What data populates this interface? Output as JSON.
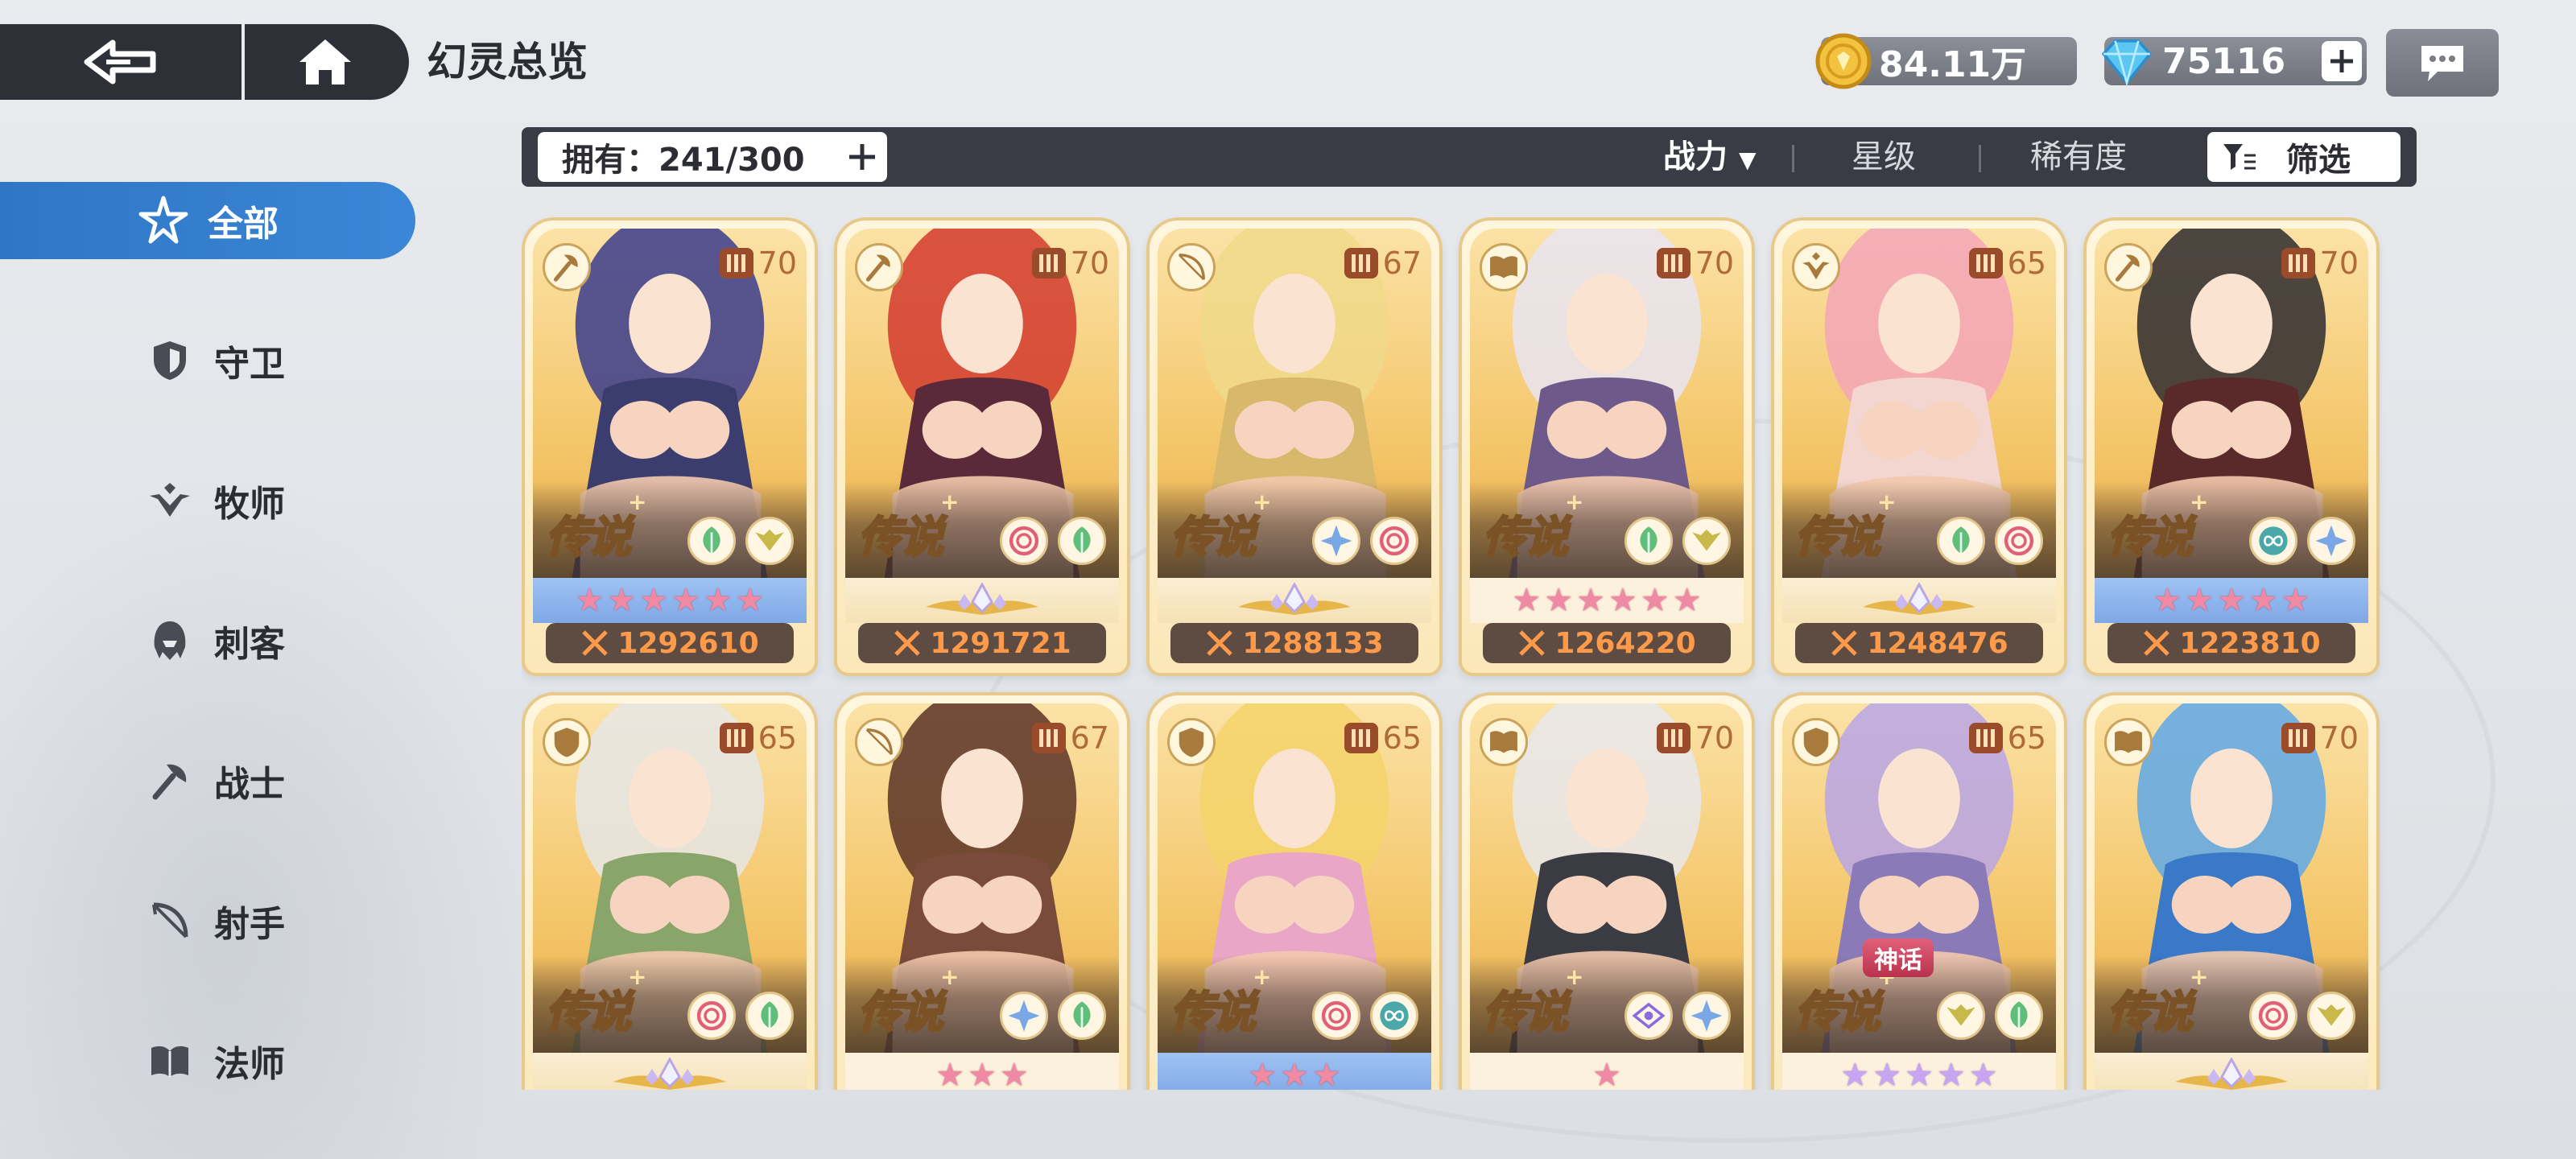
{
  "header": {
    "title": "幻灵总览",
    "back_icon": "back-arrow-icon",
    "home_icon": "home-icon"
  },
  "currency": {
    "gold": "84.11万",
    "gems": "75116",
    "plus": "+"
  },
  "sidebar": {
    "items": [
      {
        "label": "全部",
        "icon": "all-star-icon",
        "active": true
      },
      {
        "label": "守卫",
        "icon": "shield-icon",
        "active": false
      },
      {
        "label": "牧师",
        "icon": "priest-icon",
        "active": false
      },
      {
        "label": "刺客",
        "icon": "assassin-icon",
        "active": false
      },
      {
        "label": "战士",
        "icon": "axe-icon",
        "active": false
      },
      {
        "label": "射手",
        "icon": "bow-icon",
        "active": false
      },
      {
        "label": "法师",
        "icon": "book-icon",
        "active": false
      }
    ]
  },
  "filter_bar": {
    "owned": "拥有：241/300",
    "sort_power": "战力",
    "sort_power_arrow": "▼",
    "sort_star": "星级",
    "sort_rarity": "稀有度",
    "filter": "筛选"
  },
  "cards": [
    {
      "class": "axe-icon",
      "level": "70",
      "rarity": "传说",
      "elements": [
        "leaf-icon",
        "wings-icon"
      ],
      "star_style": "blue",
      "stars": 6,
      "power": "1292610",
      "tone": "#3b3d6e",
      "hair": "#3a3c8c"
    },
    {
      "class": "axe-icon",
      "level": "70",
      "rarity": "传说",
      "elements": [
        "spiral-icon",
        "leaf-icon"
      ],
      "star_style": "gold",
      "stars": 0,
      "power": "1291721",
      "tone": "#5a2a3a",
      "hair": "#d43a2e"
    },
    {
      "class": "bow-icon",
      "level": "67",
      "rarity": "传说",
      "elements": [
        "star-icon",
        "spiral-icon"
      ],
      "star_style": "gold",
      "stars": 0,
      "power": "1288133",
      "tone": "#d8b86a",
      "hair": "#f0d98a"
    },
    {
      "class": "book-icon",
      "level": "70",
      "rarity": "传说",
      "elements": [
        "leaf-icon",
        "wings-icon"
      ],
      "star_style": "plain",
      "stars": 6,
      "power": "1264220",
      "tone": "#6e5a8a",
      "hair": "#e9e4f2"
    },
    {
      "class": "priest-icon",
      "level": "65",
      "rarity": "传说",
      "elements": [
        "leaf-icon",
        "spiral-icon"
      ],
      "star_style": "gold",
      "stars": 0,
      "power": "1248476",
      "tone": "#f2d6cf",
      "hair": "#f3a6b8"
    },
    {
      "class": "axe-icon",
      "level": "70",
      "rarity": "传说",
      "elements": [
        "infinity-icon",
        "star-icon"
      ],
      "star_style": "blue",
      "stars": 5,
      "power": "1223810",
      "tone": "#5a2a2a",
      "hair": "#2e2a2e"
    },
    {
      "class": "shield-icon",
      "level": "65",
      "rarity": "传说",
      "elements": [
        "spiral-icon",
        "leaf-icon"
      ],
      "star_style": "gold",
      "stars": 0,
      "power": "",
      "tone": "#8aa56a",
      "hair": "#e6e6e6"
    },
    {
      "class": "bow-icon",
      "level": "67",
      "rarity": "传说",
      "elements": [
        "star-icon",
        "leaf-icon"
      ],
      "star_style": "plain",
      "stars": 3,
      "power": "",
      "tone": "#7a4a3a",
      "hair": "#5a3326"
    },
    {
      "class": "shield-icon",
      "level": "65",
      "rarity": "传说",
      "elements": [
        "spiral-icon",
        "infinity-icon"
      ],
      "star_style": "blue",
      "stars": 3,
      "power": "",
      "tone": "#e9a6c6",
      "hair": "#f4d36a"
    },
    {
      "class": "book-icon",
      "level": "70",
      "rarity": "传说",
      "elements": [
        "eye-icon",
        "star-icon"
      ],
      "star_style": "plain",
      "stars": 1,
      "power": "",
      "tone": "#3b3b44",
      "hair": "#e8e8ec"
    },
    {
      "class": "shield-icon",
      "level": "65",
      "rarity": "传说",
      "badge": "神话",
      "elements": [
        "wings-icon",
        "leaf-icon"
      ],
      "star_style": "purple",
      "stars": 5,
      "power": "",
      "tone": "#8a7ab8",
      "hair": "#b8a6e6"
    },
    {
      "class": "book-icon",
      "level": "70",
      "rarity": "传说",
      "elements": [
        "spiral-icon",
        "wings-icon"
      ],
      "star_style": "gold",
      "stars": 0,
      "power": "",
      "tone": "#3a78c8",
      "hair": "#5ea8e8"
    }
  ]
}
